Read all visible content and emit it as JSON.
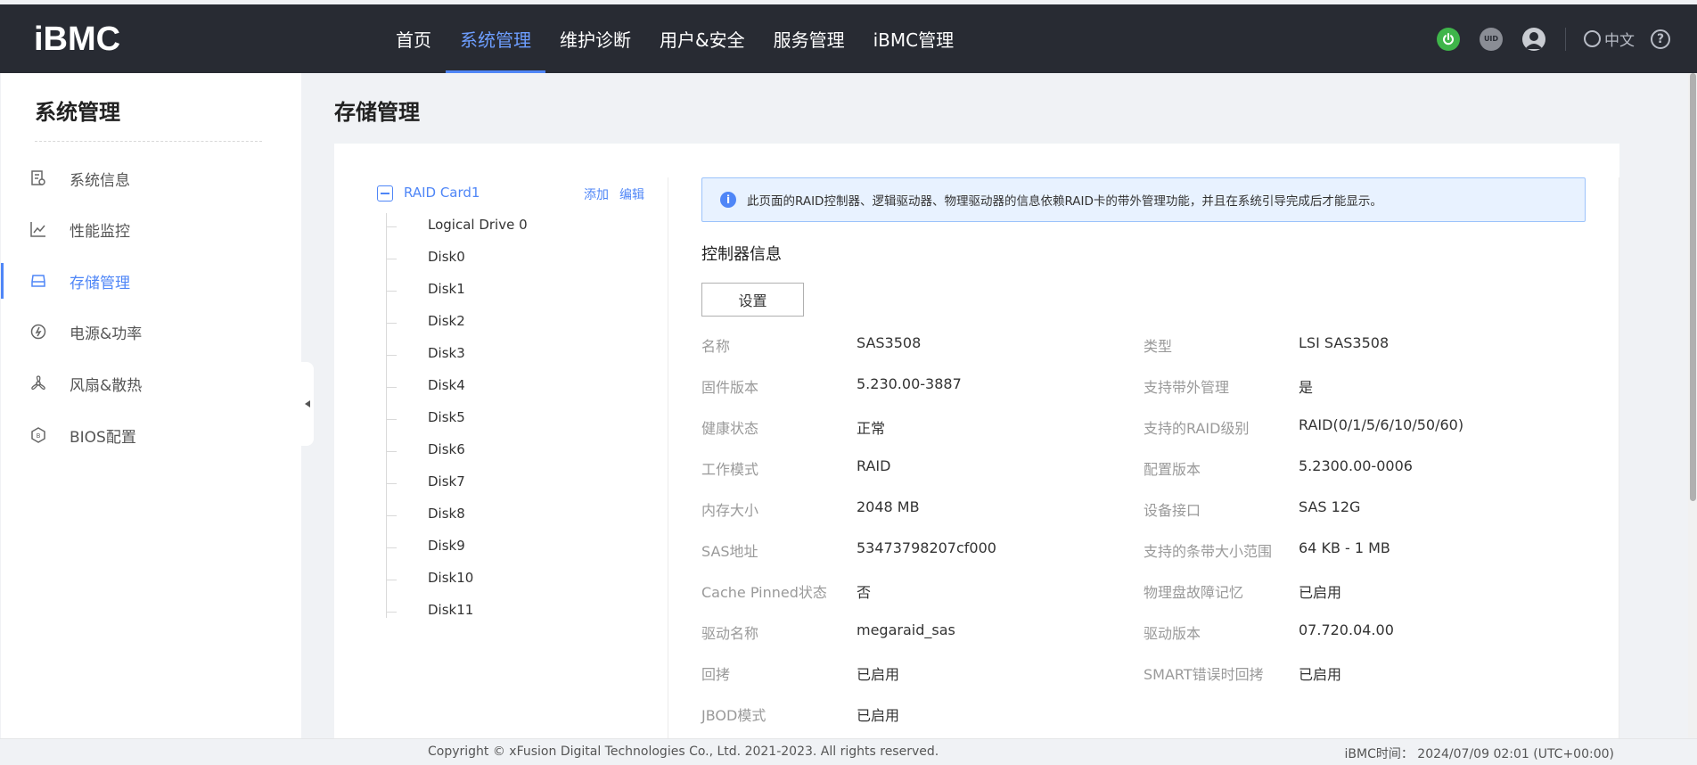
{
  "app": {
    "logo": "iBMC"
  },
  "nav": {
    "items": [
      {
        "label": "首页",
        "active": false
      },
      {
        "label": "系统管理",
        "active": true
      },
      {
        "label": "维护诊断",
        "active": false
      },
      {
        "label": "用户&安全",
        "active": false
      },
      {
        "label": "服务管理",
        "active": false
      },
      {
        "label": "iBMC管理",
        "active": false
      }
    ],
    "uid_text": "UID",
    "language": "中文",
    "help": "?"
  },
  "sidebar": {
    "title": "系统管理",
    "items": [
      {
        "label": "系统信息",
        "icon": "system-info-icon"
      },
      {
        "label": "性能监控",
        "icon": "chart-icon"
      },
      {
        "label": "存储管理",
        "icon": "storage-icon",
        "active": true
      },
      {
        "label": "电源&功率",
        "icon": "power-icon"
      },
      {
        "label": "风扇&散热",
        "icon": "fan-icon"
      },
      {
        "label": "BIOS配置",
        "icon": "bios-icon"
      }
    ]
  },
  "page": {
    "title": "存储管理"
  },
  "tree": {
    "root": "RAID Card1",
    "add": "添加",
    "edit": "编辑",
    "children": [
      "Logical Drive 0",
      "Disk0",
      "Disk1",
      "Disk2",
      "Disk3",
      "Disk4",
      "Disk5",
      "Disk6",
      "Disk7",
      "Disk8",
      "Disk9",
      "Disk10",
      "Disk11"
    ]
  },
  "banner": {
    "text": "此页面的RAID控制器、逻辑驱动器、物理驱动器的信息依赖RAID卡的带外管理功能，并且在系统引导完成后才能显示。"
  },
  "controller": {
    "title": "控制器信息",
    "settings_button": "设置",
    "left": [
      {
        "label": "名称",
        "value": "SAS3508"
      },
      {
        "label": "固件版本",
        "value": "5.230.00-3887"
      },
      {
        "label": "健康状态",
        "value": "正常"
      },
      {
        "label": "工作模式",
        "value": "RAID"
      },
      {
        "label": "内存大小",
        "value": "2048 MB"
      },
      {
        "label": "SAS地址",
        "value": "53473798207cf000"
      },
      {
        "label": "Cache Pinned状态",
        "value": "否"
      },
      {
        "label": "驱动名称",
        "value": "megaraid_sas"
      },
      {
        "label": "回拷",
        "value": "已启用"
      },
      {
        "label": "JBOD模式",
        "value": "已启用"
      }
    ],
    "right": [
      {
        "label": "类型",
        "value": "LSI SAS3508"
      },
      {
        "label": "支持带外管理",
        "value": "是"
      },
      {
        "label": "支持的RAID级别",
        "value": "RAID(0/1/5/6/10/50/60)"
      },
      {
        "label": "配置版本",
        "value": "5.2300.00-0006"
      },
      {
        "label": "设备接口",
        "value": "SAS 12G"
      },
      {
        "label": "支持的条带大小范围",
        "value": "64 KB - 1 MB"
      },
      {
        "label": "物理盘故障记忆",
        "value": "已启用"
      },
      {
        "label": "驱动版本",
        "value": "07.720.04.00"
      },
      {
        "label": "SMART错误时回拷",
        "value": "已启用"
      }
    ]
  },
  "footer": {
    "copyright": "Copyright © xFusion Digital Technologies Co., Ltd. 2021-2023. All rights reserved.",
    "time": "iBMC时间： 2024/07/09 02:01 (UTC+00:00)"
  },
  "colors": {
    "accent": "#4f86f7",
    "topbar": "#282b33",
    "power": "#3fb54a"
  }
}
